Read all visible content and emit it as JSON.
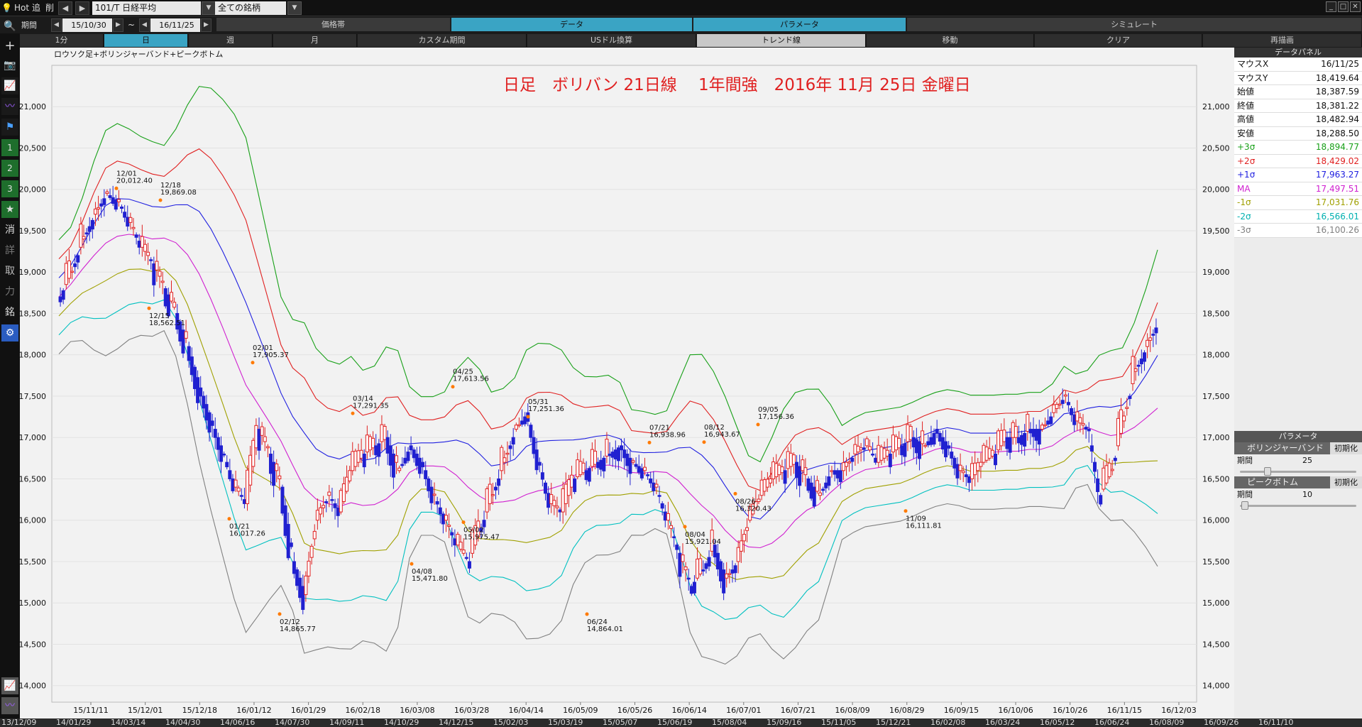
{
  "topbar": {
    "hot": "Hot",
    "tsui": "追",
    "saku": "削",
    "symbol": "101/T 日経平均",
    "scope": "全ての銘柄",
    "prev": "◀",
    "next": "▶"
  },
  "row2": {
    "period_label": "期間",
    "start": "15/10/30",
    "tilde": "~",
    "end": "16/11/25",
    "tabs": [
      "価格帯",
      "データ",
      "パラメータ",
      "シミュレート"
    ]
  },
  "row3": {
    "tabs": [
      "1分",
      "日",
      "週",
      "月",
      "カスタム期間",
      "USドル換算",
      "トレンド線",
      "移動",
      "クリア",
      "再描画"
    ]
  },
  "leftbar": {
    "items": [
      "消",
      "詳",
      "取",
      "力",
      "銘"
    ]
  },
  "chart": {
    "subtitle": "ロウソク足+ボリンジャーバンド+ピークボトム",
    "annotation": "日足　ボリバン 21日線　 1年間強　2016年 11月 25日 金曜日"
  },
  "chart_data": {
    "type": "candlestick",
    "y_ticks": [
      "21,000",
      "20,500",
      "20,000",
      "19,500",
      "19,000",
      "18,500",
      "18,000",
      "17,500",
      "17,000",
      "16,500",
      "16,000",
      "15,500",
      "15,000",
      "14,500",
      "14,000"
    ],
    "ylim": [
      13800,
      21500
    ],
    "x_ticks": [
      "15/11/11",
      "15/12/01",
      "15/12/18",
      "16/01/12",
      "16/01/29",
      "16/02/18",
      "16/03/08",
      "16/03/28",
      "16/04/14",
      "16/05/09",
      "16/05/26",
      "16/06/14",
      "16/07/01",
      "16/07/21",
      "16/08/09",
      "16/08/29",
      "16/09/15",
      "16/10/06",
      "16/10/26",
      "16/11/15",
      "16/12/03"
    ],
    "peaks": [
      {
        "date": "12/01",
        "value": "20,012.40"
      },
      {
        "date": "12/18",
        "value": "19,869.08"
      },
      {
        "date": "12/15",
        "value": "18,562.51"
      },
      {
        "date": "02/01",
        "value": "17,905.37"
      },
      {
        "date": "01/21",
        "value": "16,017.26"
      },
      {
        "date": "02/12",
        "value": "14,865.77"
      },
      {
        "date": "03/14",
        "value": "17,291.35"
      },
      {
        "date": "04/08",
        "value": "15,471.80"
      },
      {
        "date": "04/25",
        "value": "17,613.56"
      },
      {
        "date": "05/02",
        "value": "15,975.47"
      },
      {
        "date": "05/31",
        "value": "17,251.36"
      },
      {
        "date": "06/24",
        "value": "14,864.01"
      },
      {
        "date": "07/21",
        "value": "16,938.96"
      },
      {
        "date": "08/04",
        "value": "15,921.04"
      },
      {
        "date": "08/12",
        "value": "16,943.67"
      },
      {
        "date": "08/26",
        "value": "16,320.43"
      },
      {
        "date": "09/05",
        "value": "17,156.36"
      },
      {
        "date": "11/09",
        "value": "16,111.81"
      }
    ],
    "series": [
      {
        "name": "+3σ",
        "color": "#18a018"
      },
      {
        "name": "+2σ",
        "color": "#e02020"
      },
      {
        "name": "+1σ",
        "color": "#2020e0"
      },
      {
        "name": "MA",
        "color": "#d020d0"
      },
      {
        "name": "-1σ",
        "color": "#a0a000"
      },
      {
        "name": "-2σ",
        "color": "#00c0c0"
      },
      {
        "name": "-3σ",
        "color": "#808080"
      }
    ],
    "close_path": [
      18700,
      19000,
      19400,
      19700,
      19950,
      19850,
      19600,
      19300,
      19100,
      18800,
      18500,
      18100,
      17600,
      17200,
      16800,
      16400,
      16200,
      17100,
      16800,
      16400,
      15500,
      15100,
      16000,
      16300,
      16100,
      16600,
      16800,
      16900,
      17000,
      16600,
      16900,
      16700,
      16300,
      16000,
      15700,
      15500,
      15900,
      16300,
      16700,
      17100,
      17300,
      16700,
      16200,
      16100,
      16500,
      16600,
      16700,
      16800,
      16900,
      16700,
      16600,
      16400,
      16000,
      15600,
      15200,
      15400,
      15700,
      15300,
      15500,
      16000,
      16300,
      16500,
      16600,
      16700,
      16500,
      16300,
      16600,
      16600,
      16800,
      16900,
      16700,
      16800,
      16900,
      17000,
      16900,
      17100,
      16900,
      16600,
      16500,
      16700,
      16800,
      17000,
      17000,
      17100,
      17100,
      17300,
      17500,
      17200,
      17100,
      16300,
      16600,
      17200,
      17800,
      18100,
      18400
    ]
  },
  "datapanel": {
    "title": "データパネル",
    "rows": [
      {
        "k": "マウスX",
        "v": "16/11/25",
        "c": "#111"
      },
      {
        "k": "マウスY",
        "v": "18,419.64",
        "c": "#111"
      },
      {
        "k": "始値",
        "v": "18,387.59",
        "c": "#111"
      },
      {
        "k": "終値",
        "v": "18,381.22",
        "c": "#111"
      },
      {
        "k": "高値",
        "v": "18,482.94",
        "c": "#111"
      },
      {
        "k": "安値",
        "v": "18,288.50",
        "c": "#111"
      },
      {
        "k": "+3σ",
        "v": "18,894.77",
        "c": "#18a018"
      },
      {
        "k": "+2σ",
        "v": "18,429.02",
        "c": "#e02020"
      },
      {
        "k": "+1σ",
        "v": "17,963.27",
        "c": "#2020e0"
      },
      {
        "k": "MA",
        "v": "17,497.51",
        "c": "#d020d0"
      },
      {
        "k": "-1σ",
        "v": "17,031.76",
        "c": "#a0a000"
      },
      {
        "k": "-2σ",
        "v": "16,566.01",
        "c": "#00b0b0"
      },
      {
        "k": "-3σ",
        "v": "16,100.26",
        "c": "#808080"
      }
    ]
  },
  "param": {
    "title": "パラメータ",
    "bb_title": "ボリンジャーバンド",
    "bb_reset": "初期化",
    "bb_period_label": "期間",
    "bb_period": "25",
    "pb_title": "ピークボトム",
    "pb_reset": "初期化",
    "pb_period_label": "期間",
    "pb_period": "10"
  },
  "bottombar": {
    "dates": [
      "13/12/09",
      "14/01/29",
      "14/03/14",
      "14/04/30",
      "14/06/16",
      "14/07/30",
      "14/09/11",
      "14/10/29",
      "14/12/15",
      "15/02/03",
      "15/03/19",
      "15/05/07",
      "15/06/19",
      "15/08/04",
      "15/09/16",
      "15/11/05",
      "15/12/21",
      "16/02/08",
      "16/03/24",
      "16/05/12",
      "16/06/24",
      "16/08/09",
      "16/09/26",
      "16/11/10"
    ]
  }
}
